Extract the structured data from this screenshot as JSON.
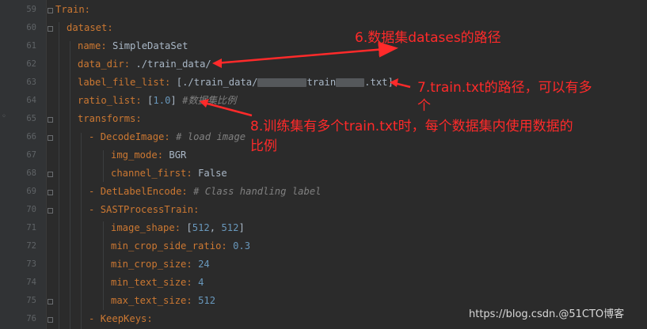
{
  "line_numbers": [
    "59",
    "60",
    "61",
    "62",
    "63",
    "64",
    "65",
    "66",
    "67",
    "68",
    "69",
    "70",
    "71",
    "72",
    "73",
    "74",
    "75",
    "76"
  ],
  "code": {
    "train": "Train:",
    "dataset": "dataset:",
    "name_key": "name:",
    "name_val": " SimpleDataSet",
    "data_dir_key": "data_dir:",
    "data_dir_val": " ./train_data/",
    "label_file_key": "label_file_list:",
    "label_file_val_a": " [./train_data/",
    "label_file_val_b": "train",
    "label_file_val_c": ".txt]",
    "ratio_key": "ratio_list:",
    "ratio_val_a": " [",
    "ratio_num": "1.0",
    "ratio_val_b": "]",
    "ratio_comment": " #数据集比例",
    "transforms": "transforms:",
    "decode_key": "DecodeImage:",
    "decode_comment": " # load image",
    "img_mode_key": "img_mode:",
    "img_mode_val": " BGR",
    "channel_first_key": "channel_first:",
    "channel_first_val": " False",
    "det_label_key": "DetLabelEncode:",
    "det_label_comment": " # Class handling label",
    "sast_key": "SASTProcessTrain:",
    "image_shape_key": "image_shape:",
    "image_shape_val_a": " [",
    "image_shape_n1": "512",
    "image_shape_sep": ", ",
    "image_shape_n2": "512",
    "image_shape_val_b": "]",
    "min_crop_side_key": "min_crop_side_ratio:",
    "min_crop_side_val": "0.3",
    "min_crop_size_key": "min_crop_size:",
    "min_crop_size_val": "24",
    "min_text_key": "min_text_size:",
    "min_text_val": "4",
    "max_text_key": "max_text_size:",
    "max_text_val": "512",
    "keepkeys_key": "KeepKeys:",
    "dash": "- "
  },
  "annotations": {
    "a6": "6.数据集datases的路径",
    "a7_line1": "7.train.txt的路径，可以有多",
    "a7_line2": "个",
    "a8_line1": "8.训练集有多个train.txt时，每个数据集内使用数据的",
    "a8_line2": "比例"
  },
  "watermark": "https://blog.csdn.@51CTO博客",
  "colors": {
    "annotation": "#ff2a2a",
    "background": "#2b2b2b",
    "key": "#cc7832",
    "number": "#6897bb",
    "comment": "#808080"
  }
}
